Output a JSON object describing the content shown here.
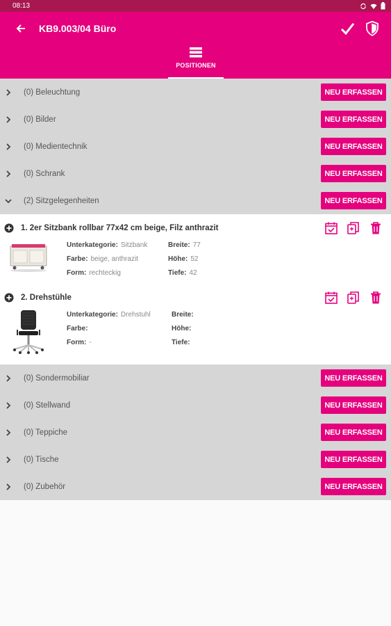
{
  "status": {
    "time": "08:13"
  },
  "appbar": {
    "title": "KB9.003/04 Büro"
  },
  "tab": {
    "label": "POSITIONEN"
  },
  "new_label": "NEU ERFASSEN",
  "categories_top": [
    {
      "label": "(0)  Beleuchtung"
    },
    {
      "label": "(0)  Bilder"
    },
    {
      "label": "(0)  Medientechnik"
    },
    {
      "label": "(0)  Schrank"
    },
    {
      "label": "(2)  Sitzgelegenheiten"
    }
  ],
  "items": [
    {
      "title": "1. 2er Sitzbank rollbar 77x42 cm beige, Filz anthrazit",
      "labels": {
        "unterkategorie": "Unterkategorie:",
        "farbe": "Farbe:",
        "form": "Form:",
        "breite": "Breite:",
        "hoehe": "Höhe:",
        "tiefe": "Tiefe:"
      },
      "unterkategorie": "Sitzbank",
      "farbe": "beige, anthrazit",
      "form": "rechteckig",
      "breite": "77",
      "hoehe": "52",
      "tiefe": "42"
    },
    {
      "title": "2. Drehstühle",
      "labels": {
        "unterkategorie": "Unterkategorie:",
        "farbe": "Farbe:",
        "form": "Form:",
        "breite": "Breite:",
        "hoehe": "Höhe:",
        "tiefe": "Tiefe:"
      },
      "unterkategorie": "Drehstuhl",
      "farbe": "",
      "form": "-",
      "breite": "",
      "hoehe": "",
      "tiefe": ""
    }
  ],
  "categories_bottom": [
    {
      "label": "(0)  Sondermobiliar"
    },
    {
      "label": "(0)  Stellwand"
    },
    {
      "label": "(0)  Teppiche"
    },
    {
      "label": "(0)  Tische"
    },
    {
      "label": "(0)  Zubehör"
    }
  ],
  "colors": {
    "accent": "#e5007d",
    "statusbar": "#a8174f",
    "category_bg": "#d6d6d6"
  },
  "icons": [
    "back-arrow-icon",
    "check-icon",
    "shield-icon",
    "menu-icon",
    "chevron-right-icon",
    "chevron-down-icon",
    "add-circle-icon",
    "calendar-check-icon",
    "copy-icon",
    "trash-icon"
  ]
}
